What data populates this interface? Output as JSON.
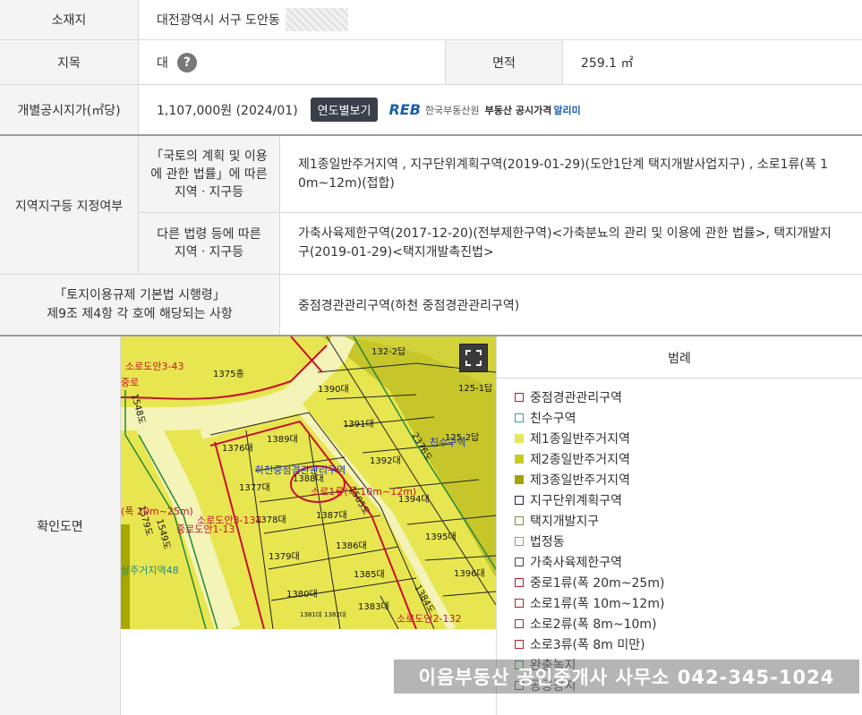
{
  "location": {
    "label": "소재지",
    "value": "대전광역시 서구 도안동"
  },
  "land_category": {
    "label": "지목",
    "value": "대",
    "help": "?"
  },
  "area": {
    "label": "면적",
    "value": "259.1 ㎡"
  },
  "price": {
    "label": "개별공시지가(㎡당)",
    "value": "1,107,000원 (2024/01)",
    "yearly_button": "연도별보기",
    "reb_logo": "REB",
    "reb_org": "한국부동산원",
    "reb_service": "부동산 공시가격",
    "reb_alimi": "알리미"
  },
  "zoning": {
    "label": "지역지구등 지정여부",
    "national_label_l1": "「국토의 계획 및 이용",
    "national_label_l2": "에 관한 법률」에 따른",
    "national_label_l3": "지역ㆍ지구등",
    "national_value_l1": "제1종일반주거지역 , 지구단위계획구역(2019-01-29)(도안1단계 택지개발사업지구) , 소로1류(폭 1",
    "national_value_l2": "0m~12m)(접합)",
    "other_label_l1": "다른 법령 등에 따른",
    "other_label_l2": "지역ㆍ지구등",
    "other_value_l1": "가축사육제한구역(2017-12-20)(전부제한구역)<가축분뇨의 관리 및 이용에 관한 법률>, 택지개발지",
    "other_value_l2": "구(2019-01-29)<택지개발촉진법>"
  },
  "enforcement": {
    "label_l1": "「토지이용규제 기본법 시행령」",
    "label_l2": "제9조 제4항 각 호에 해당되는 사항",
    "value": "중점경관관리구역(하천 중점경관관리구역)"
  },
  "map": {
    "label": "확인도면",
    "parcels": [
      "1375종",
      "1390대",
      "1391대",
      "1376대",
      "1389대",
      "1392대",
      "1377대",
      "1388대",
      "1387대",
      "1394대",
      "1378대",
      "1386대",
      "1395대",
      "1379대",
      "1385대",
      "1396대",
      "1380대",
      "1383대",
      "1384도",
      "132-2답",
      "125-1답",
      "125-2답",
      "1382대",
      "1381대"
    ],
    "annotations": [
      "소로도안3-43",
      "중로",
      "하천중점경관관리구역",
      "소로1류(폭 10m~12m)",
      "(폭 20m~25m)",
      "소로도안3-134",
      "중로도안1-13",
      "상주거지역48",
      "소로도안2-132",
      "2376도",
      "친수구역",
      "1505도",
      "1549도",
      "1579도",
      "1548도"
    ],
    "fullscreen_icon": "expand-icon"
  },
  "legend": {
    "title": "범례",
    "items": [
      {
        "label": "중점경관관리구역",
        "color": "#c8102e",
        "fill": "none"
      },
      {
        "label": "친수구역",
        "color": "#2aa7a0",
        "fill": "none"
      },
      {
        "label": "제1종일반주거지역",
        "color": "#e6e65a",
        "fill": "#e6e65a"
      },
      {
        "label": "제2종일반주거지역",
        "color": "#c9c926",
        "fill": "#c9c926"
      },
      {
        "label": "제3종일반주거지역",
        "color": "#a3a300",
        "fill": "#a3a300"
      },
      {
        "label": "지구단위계획구역",
        "color": "#222244",
        "fill": "none"
      },
      {
        "label": "택지개발지구",
        "color": "#888844",
        "fill": "none"
      },
      {
        "label": "법정동",
        "color": "#999977",
        "fill": "none"
      },
      {
        "label": "가축사육제한구역",
        "color": "#444444",
        "fill": "none"
      },
      {
        "label": "중로1류(폭 20m~25m)",
        "color": "#b02030",
        "fill": "none"
      },
      {
        "label": "소로1류(폭 10m~12m)",
        "color": "#b02030",
        "fill": "none"
      },
      {
        "label": "소로2류(폭 8m~10m)",
        "color": "#b02030",
        "fill": "none"
      },
      {
        "label": "소로3류(폭 8m 미만)",
        "color": "#b02030",
        "fill": "none"
      },
      {
        "label": "완충녹지",
        "color": "#2a9a3a",
        "fill": "none"
      },
      {
        "label": "공공공지",
        "color": "#b02030",
        "fill": "none"
      }
    ]
  },
  "watermark": "이음부동산 공인중개사 사무소 042-345-1024"
}
